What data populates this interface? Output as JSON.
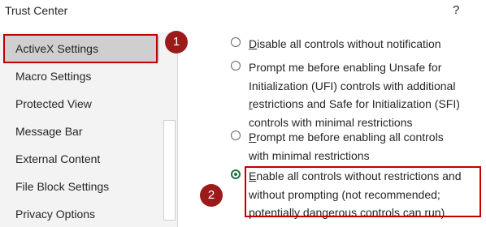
{
  "window": {
    "title": "Trust Center",
    "help": "?"
  },
  "sidebar": {
    "items": [
      {
        "label": "ActiveX Settings",
        "selected": true
      },
      {
        "label": "Macro Settings"
      },
      {
        "label": "Protected View"
      },
      {
        "label": "Message Bar"
      },
      {
        "label": "External Content"
      },
      {
        "label": "File Block Settings"
      },
      {
        "label": "Privacy Options"
      }
    ]
  },
  "options": [
    {
      "key": "D",
      "rest": "isable all controls without notification",
      "checked": false
    },
    {
      "line1": "Prompt me before enabling Unsafe for",
      "line2": "Initialization (UFI) controls with additional",
      "key": "r",
      "line3rest": "estrictions and Safe for Initialization (SFI)",
      "line4": "controls with minimal restrictions",
      "checked": false
    },
    {
      "key": "P",
      "line1rest": "rompt me before enabling all controls",
      "line2": "with minimal restrictions",
      "checked": false
    },
    {
      "key": "E",
      "line1rest": "nable all controls without restrictions and",
      "line2": "without prompting (not recommended;",
      "line3": "potentially dangerous controls can run)",
      "checked": true
    }
  ],
  "annotations": {
    "badge1": "1",
    "badge2": "2"
  },
  "colors": {
    "highlight": "#c00000",
    "badge": "#9b1b1b",
    "radio_checked": "#1e7145"
  }
}
